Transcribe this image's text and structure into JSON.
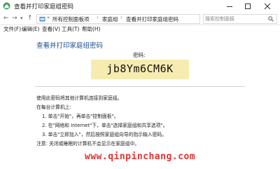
{
  "window": {
    "title": "查看并打印家庭组密码"
  },
  "address": {
    "crumbs": [
      "所有控制面板项",
      "家庭组",
      "查看并打印家庭组密码"
    ],
    "search_placeholder": "搜索控制面板"
  },
  "menu": {
    "items": [
      "文件(F)",
      "编辑(E)",
      "查看(V)",
      "工具(T)",
      "帮助(H)"
    ]
  },
  "main": {
    "title": "查看并打印家庭组密码",
    "password_label": "密码:",
    "password": "jb8Ym6CM6K",
    "instructions": {
      "intro": "使用此密码将其他计算机连接到家庭组。",
      "each_pc": "在每台计算机上:",
      "steps": [
        "1. 单击\"开始\"，再单击\"控制面板\"。",
        "2. 在\"网络和 Internet\"下，单击\"选择家庭组和共享选项\"。",
        "3. 单击\"立即加入\"，然后按照家庭组向导的指示输入密码。"
      ],
      "note": "注意: 关闭或睡眠的计算机不会显示在家庭组中。"
    }
  },
  "watermark": "www.qinpinchang.com",
  "colors": {
    "title_blue": "#1e4f8f",
    "password_bg": "#f7ecb0",
    "watermark_red": "#dd3333"
  },
  "icons": {
    "app": "homegroup-icon",
    "folder": "control-panel-icon",
    "search": "search-icon"
  }
}
